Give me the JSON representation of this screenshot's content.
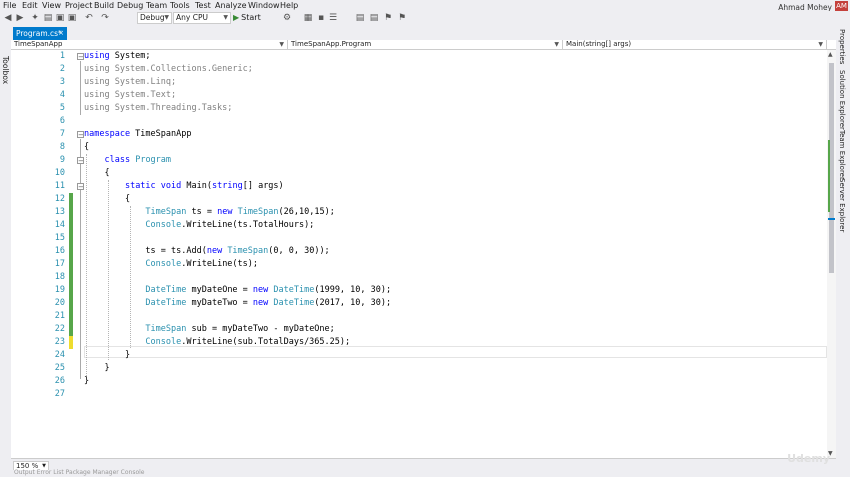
{
  "menu": {
    "items": [
      "File",
      "Edit",
      "View",
      "Project",
      "Build",
      "Debug",
      "Team",
      "Tools",
      "Test",
      "Analyze",
      "Window",
      "Help"
    ],
    "user_name": "Ahmad Mohey",
    "avatar": "AM"
  },
  "toolbar": {
    "config": "Debug",
    "platform": "Any CPU",
    "start_label": "Start"
  },
  "left_panel": {
    "toolbox_label": "Toolbox"
  },
  "right_panel": {
    "labels": [
      "Properties",
      "Solution Explorer",
      "Team Explorer",
      "Server Explorer"
    ]
  },
  "tabs": {
    "active_label": "Program.cs*"
  },
  "navbar": {
    "project": "TimeSpanApp",
    "class": "TimeSpanApp.Program",
    "member": "Main(string[] args)"
  },
  "editor": {
    "line_numbers": [
      "1",
      "2",
      "3",
      "4",
      "5",
      "6",
      "7",
      "8",
      "9",
      "10",
      "11",
      "12",
      "13",
      "14",
      "15",
      "16",
      "17",
      "18",
      "19",
      "20",
      "21",
      "22",
      "23",
      "24",
      "25",
      "26",
      "27"
    ],
    "lines": [
      "using System;",
      "using System.Collections.Generic;",
      "using System.Linq;",
      "using System.Text;",
      "using System.Threading.Tasks;",
      "",
      "namespace TimeSpanApp",
      "{",
      "    class Program",
      "    {",
      "        static void Main(string[] args)",
      "        {",
      "            TimeSpan ts = new TimeSpan(26,10,15);",
      "            Console.WriteLine(ts.TotalHours);",
      "",
      "            ts = ts.Add(new TimeSpan(0, 0, 30));",
      "            Console.WriteLine(ts);",
      "",
      "            DateTime myDateOne = new DateTime(1999, 10, 30);",
      "            DateTime myDateTwo = new DateTime(2017, 10, 30);",
      "",
      "            TimeSpan sub = myDateTwo - myDateOne;",
      "            Console.WriteLine(sub.TotalDays/365.25);",
      "        }",
      "    }",
      "}",
      ""
    ]
  },
  "zoom": {
    "value": "150 %"
  },
  "status": {
    "text": "Output  Error List  Package Manager Console"
  },
  "watermark": "Udemy",
  "colors": {
    "accent": "#007acc",
    "keyword": "#0000ff",
    "type": "#2b91af",
    "changed": "#57a64a",
    "unsaved": "#eedc2e"
  }
}
